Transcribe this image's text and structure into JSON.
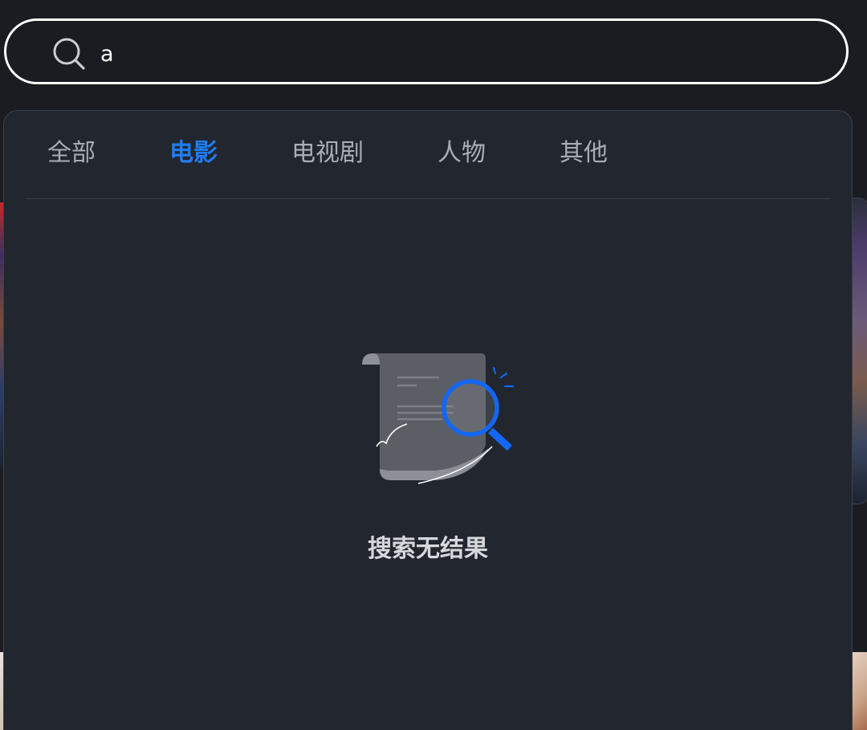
{
  "search": {
    "value": "a",
    "icon": "search-icon"
  },
  "tabs": [
    {
      "label": "全部",
      "active": false
    },
    {
      "label": "电影",
      "active": true
    },
    {
      "label": "电视剧",
      "active": false
    },
    {
      "label": "人物",
      "active": false
    },
    {
      "label": "其他",
      "active": false
    }
  ],
  "empty_state": {
    "icon": "no-results-document-magnifier-icon",
    "message": "搜索无结果"
  },
  "colors": {
    "background": "#1a1c21",
    "panel": "#22262e",
    "accent": "#1f7df0",
    "tab_text": "#a9adb5"
  }
}
